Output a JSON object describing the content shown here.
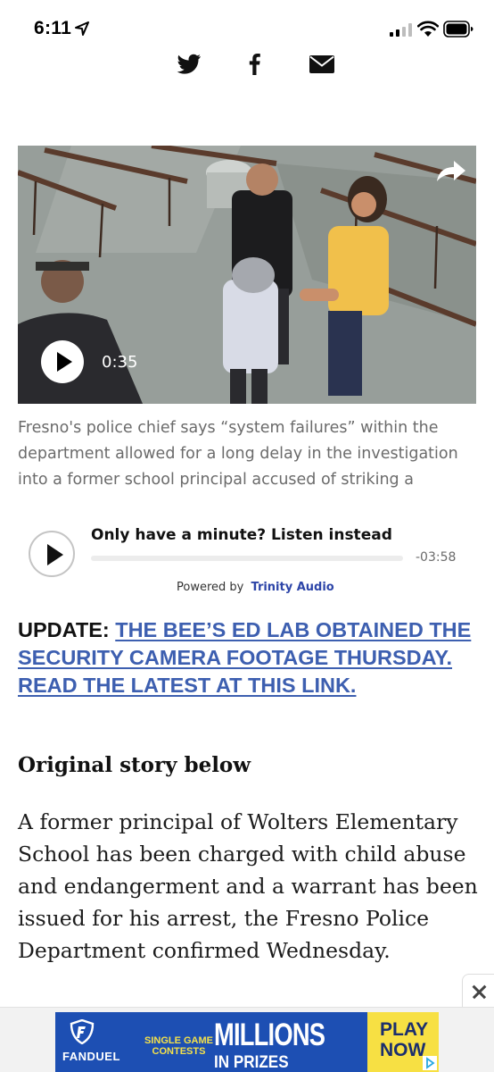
{
  "status_bar": {
    "time": "6:11"
  },
  "share": {
    "icons": [
      "twitter-icon",
      "facebook-icon",
      "mail-icon"
    ]
  },
  "video": {
    "duration": "0:35",
    "caption": "Fresno's police chief says “system failures” within the department allowed for a long delay in the investigation into a former school principal accused of striking a"
  },
  "audio": {
    "title": "Only have a minute? Listen instead",
    "time_remaining": "-03:58",
    "powered_by_label": "Powered by",
    "powered_by_name": "Trinity Audio"
  },
  "article": {
    "update_label": "UPDATE:",
    "update_link": "THE BEE’S ED LAB OBTAINED THE SECURITY CAMERA FOOTAGE THURSDAY. READ THE LATEST AT THIS LINK.",
    "subhead": "Original story below",
    "body": "A former principal of Wolters Elementary School has been charged with child abuse and endangerment and a warrant has been issued for his arrest, the Fresno Police Department confirmed Wednesday."
  },
  "ad": {
    "brand": "FANDUEL",
    "small_line_1": "SINGLE GAME",
    "small_line_2": "CONTESTS",
    "headline": "MILLIONS",
    "subline": "IN PRIZES",
    "cta_line_1": "PLAY",
    "cta_line_2": "NOW"
  },
  "colors": {
    "link": "#3d5fb0",
    "trinity": "#2d45a8",
    "ad_blue": "#1d4fb3",
    "ad_yellow": "#f7e043"
  }
}
